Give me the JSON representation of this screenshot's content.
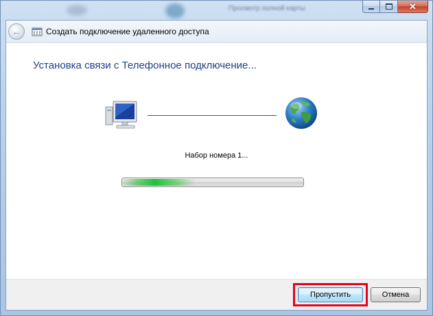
{
  "window": {
    "background_title": "Просмотр полной карты",
    "caption_buttons": {
      "minimize": "minimize-icon",
      "maximize": "maximize-icon",
      "close": "close-icon"
    }
  },
  "header": {
    "back_icon": "back-arrow-icon",
    "dialog_icon": "dialup-connection-icon",
    "title": "Создать подключение удаленного доступа"
  },
  "main": {
    "heading": "Установка связи с Телефонное подключение...",
    "left_icon": "computer-icon",
    "right_icon": "globe-icon",
    "status": "Набор номера 1...",
    "progress_state": "indeterminate (marquee)"
  },
  "footer": {
    "skip_label": "Пропустить",
    "cancel_label": "Отмена",
    "highlight_color": "#e8001c"
  },
  "colors": {
    "heading": "#1e3f8a",
    "progress_fill": "#21c23a",
    "frame": "#b3cce8"
  }
}
